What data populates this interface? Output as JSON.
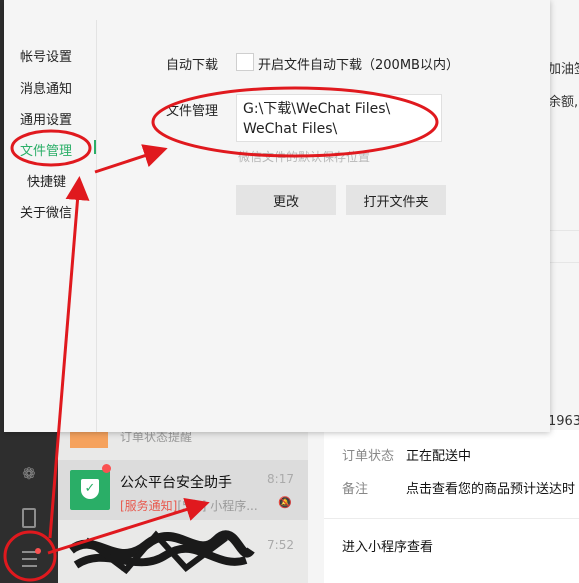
{
  "settings": {
    "nav": [
      "帐号设置",
      "消息通知",
      "通用设置",
      "文件管理",
      "快捷键",
      "关于微信"
    ],
    "auto_download_label": "自动下载",
    "auto_download_option": "开启文件自动下载（200MB以内）",
    "file_manage_label": "文件管理",
    "path_value": "G:\\下载\\WeChat Files\\\nWeChat Files\\",
    "path_hint": "微信文件的默认保存位置",
    "change_button": "更改",
    "open_folder_button": "打开文件夹"
  },
  "chat_list": {
    "prev_item_text": "订单状态提醒",
    "helper_name": "公众平台安全助手",
    "helper_time": "8:17",
    "helper_tag": "[服务通知]",
    "helper_count": "[5条]",
    "helper_preview": "小程序...",
    "third_time": "7:52",
    "third_preview": "..."
  },
  "detail": {
    "clip_1": "加油签",
    "clip_2": "余额,",
    "clip_3": "1963",
    "order_status_key": "订单状态",
    "order_status_value": "正在配送中",
    "note_key": "备注",
    "note_value": "点击查看您的商品预计送达时",
    "mini_program_link": "进入小程序查看"
  },
  "colors": {
    "accent_green": "#2aae67",
    "annotation_red": "#e0191e",
    "sidebar_dark": "#2e2e2e"
  },
  "icons": [
    "mini-program-icon",
    "phone-icon",
    "menu-icon",
    "shield-icon",
    "mute-icon"
  ]
}
